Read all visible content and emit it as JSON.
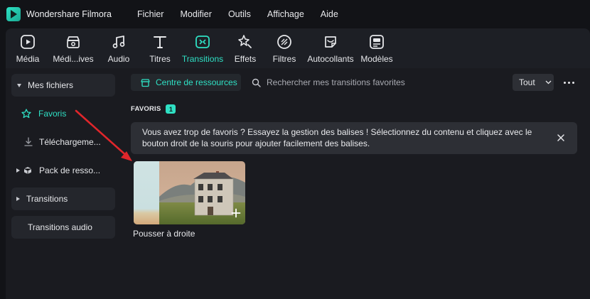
{
  "app": {
    "title": "Wondershare Filmora"
  },
  "menu": [
    {
      "label": "Fichier"
    },
    {
      "label": "Modifier"
    },
    {
      "label": "Outils"
    },
    {
      "label": "Affichage"
    },
    {
      "label": "Aide"
    }
  ],
  "toolbar": [
    {
      "label": "Média",
      "icon": "media-icon",
      "active": false
    },
    {
      "label": "Médi...ives",
      "icon": "stock-media-icon",
      "active": false
    },
    {
      "label": "Audio",
      "icon": "audio-icon",
      "active": false
    },
    {
      "label": "Titres",
      "icon": "titles-icon",
      "active": false
    },
    {
      "label": "Transitions",
      "icon": "transitions-icon",
      "active": true
    },
    {
      "label": "Effets",
      "icon": "effects-icon",
      "active": false
    },
    {
      "label": "Filtres",
      "icon": "filters-icon",
      "active": false
    },
    {
      "label": "Autocollants",
      "icon": "stickers-icon",
      "active": false
    },
    {
      "label": "Modèles",
      "icon": "templates-icon",
      "active": false
    }
  ],
  "sidebar": {
    "items": [
      {
        "label": "Mes fichiers"
      },
      {
        "label": "Favoris"
      },
      {
        "label": "Téléchargeme..."
      },
      {
        "label": "Pack de resso..."
      },
      {
        "label": "Transitions"
      },
      {
        "label": "Transitions audio"
      }
    ]
  },
  "main": {
    "resource_button": "Centre de ressources",
    "search_placeholder": "Rechercher mes transitions favorites",
    "filter_value": "Tout",
    "section_title": "FAVORIS",
    "section_count": "1",
    "notice_text": "Vous avez trop de favoris ? Essayez la gestion des balises ! Sélectionnez du contenu et cliquez avec le bouton droit de la souris pour ajouter facilement des balises.",
    "items": [
      {
        "label": "Pousser à droite"
      }
    ]
  },
  "colors": {
    "accent": "#2fe0c4",
    "arrow": "#e0262b",
    "background": "#1a1b20"
  }
}
